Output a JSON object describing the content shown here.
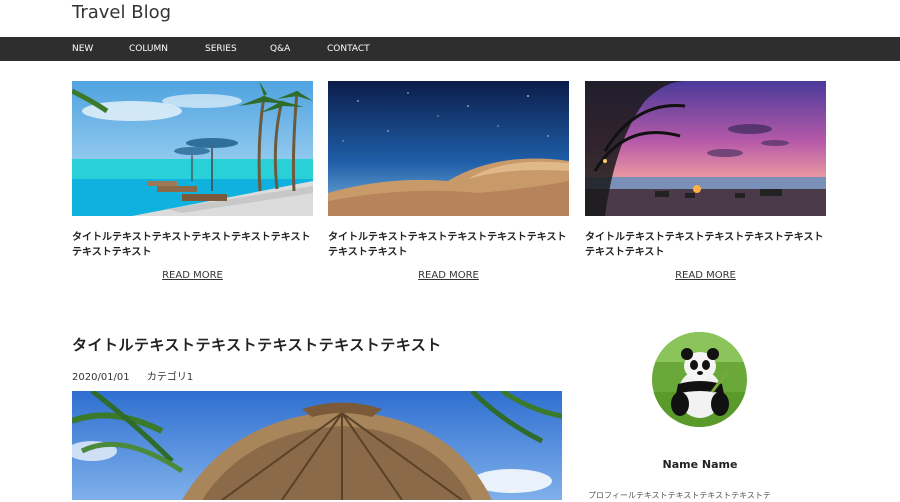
{
  "site": {
    "title": "Travel Blog"
  },
  "nav": {
    "items": [
      "NEW",
      "COLUMN",
      "SERIES",
      "Q&A",
      "CONTACT"
    ]
  },
  "cards": [
    {
      "title": "タイトルテキストテキストテキストテキストテキストテキストテキスト",
      "read_more": "READ MORE"
    },
    {
      "title": "タイトルテキストテキストテキストテキストテキストテキストテキスト",
      "read_more": "READ MORE"
    },
    {
      "title": "タイトルテキストテキストテキストテキストテキストテキストテキスト",
      "read_more": "READ MORE"
    }
  ],
  "post": {
    "title": "タイトルテキストテキストテキストテキストテキスト",
    "date": "2020/01/01",
    "category": "カテゴリ1"
  },
  "profile": {
    "name": "Name Name",
    "text": "プロフィールテキストテキストテキストテキストテ"
  },
  "colors": {
    "nav_bg": "#2e2e2e",
    "text": "#333333"
  }
}
